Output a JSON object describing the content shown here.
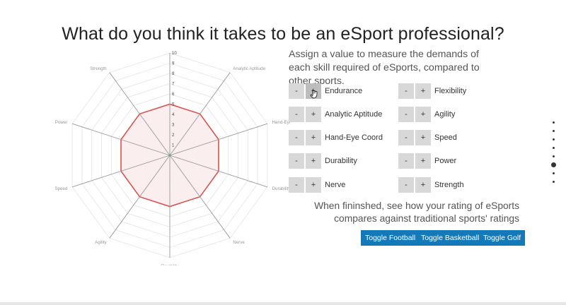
{
  "page": {
    "title": "What do you think it takes to be an eSport professional?",
    "intro": "Assign a value to measure the demands of each skill required of eSports, compared to other sports.",
    "finish_text": "When fininshed, see how your rating of eSports compares against traditional sports' ratings"
  },
  "controls": {
    "minus_label": "-",
    "plus_label": "+",
    "skills_left": [
      {
        "label": "Endurance"
      },
      {
        "label": "Analytic Aptitude"
      },
      {
        "label": "Hand-Eye Coord"
      },
      {
        "label": "Durability"
      },
      {
        "label": "Nerve"
      }
    ],
    "skills_right": [
      {
        "label": "Flexibility"
      },
      {
        "label": "Agility"
      },
      {
        "label": "Speed"
      },
      {
        "label": "Power"
      },
      {
        "label": "Strength"
      }
    ]
  },
  "toggles": {
    "football": "Toggle Football",
    "basketball": "Toggle Basketball",
    "golf": "Toggle Golf"
  },
  "pagination": {
    "count": 8,
    "active_index": 5
  },
  "chart_data": {
    "type": "radar",
    "axes": [
      "Endurance",
      "Analytic Aptitude",
      "Hand-Eye Coord",
      "Durability",
      "Nerve",
      "Flexibility",
      "Agility",
      "Speed",
      "Power",
      "Strength"
    ],
    "range": [
      0,
      10
    ],
    "ticks": [
      "1",
      "2",
      "3",
      "4",
      "5",
      "6",
      "7",
      "8",
      "9",
      "10"
    ],
    "series": [
      {
        "values": [
          5,
          5,
          5,
          5,
          5,
          5,
          5,
          5,
          5,
          5
        ],
        "color": "#d9534f",
        "fill": "#fbeeee"
      }
    ],
    "grid_color": "#e3e3e3",
    "axis_color": "#999999"
  },
  "colors": {
    "accent": "#1479b8",
    "button_gray": "#d8d8d8"
  }
}
